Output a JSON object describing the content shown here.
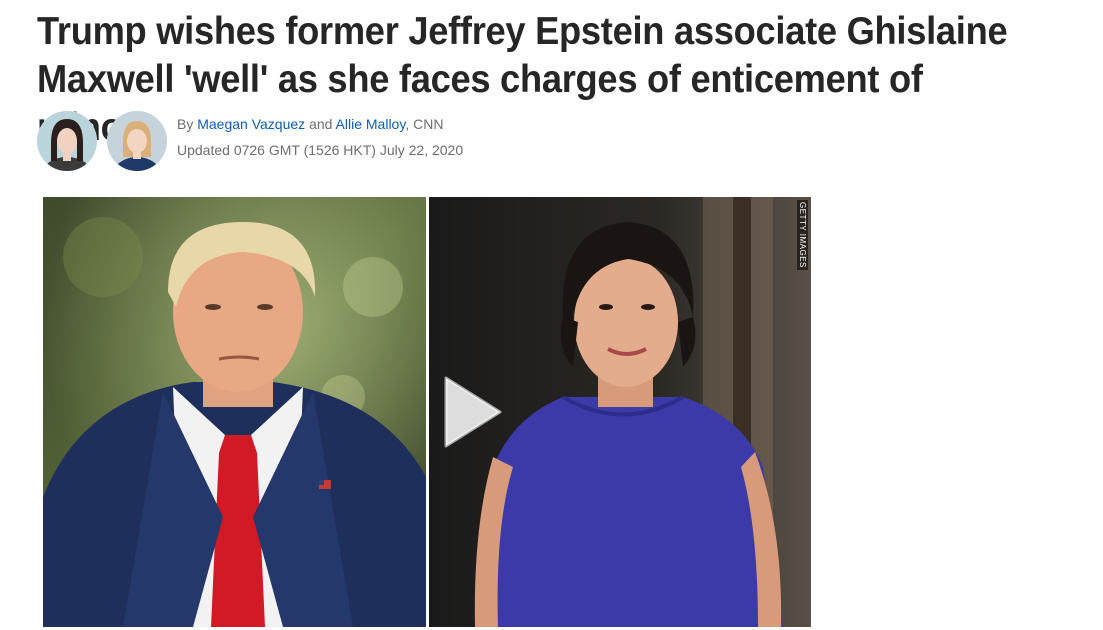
{
  "article": {
    "headline": "Trump wishes former Jeffrey Epstein associate Ghislaine Maxwell 'well' as she faces charges of enticement of minors",
    "byline_prefix": "By",
    "author_1": "Maegan Vazquez",
    "byline_and": "and",
    "author_2": "Allie Malloy",
    "byline_suffix": ", CNN",
    "timestamp": "Updated 0726 GMT (1526 HKT) July 22, 2020"
  },
  "media": {
    "credit": "GETTY IMAGES",
    "play_icon": "play-icon"
  },
  "colors": {
    "headline": "#262626",
    "link": "#0c5db8",
    "meta": "#6e6e6e"
  }
}
